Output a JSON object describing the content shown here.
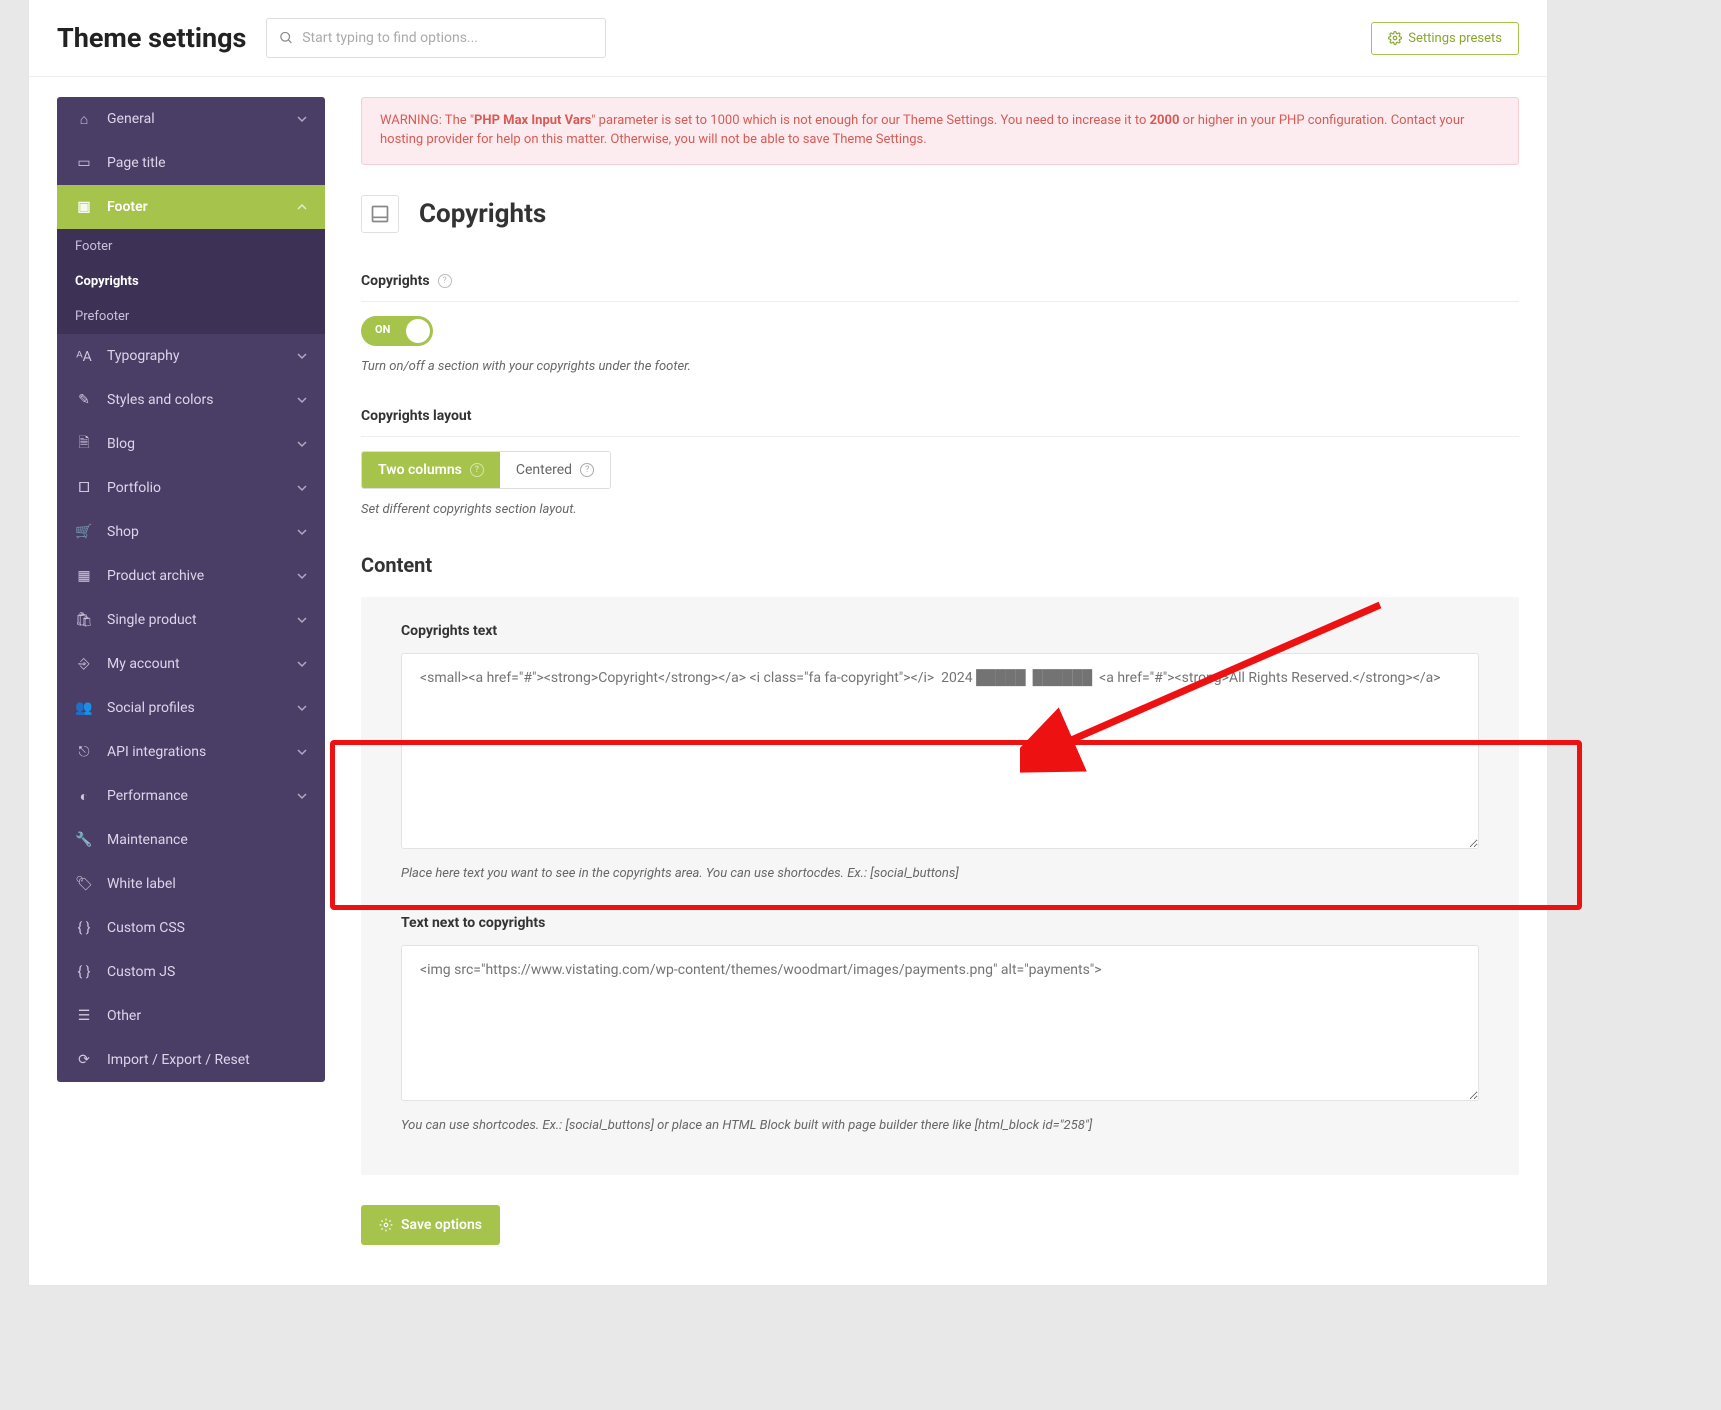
{
  "header": {
    "title": "Theme settings",
    "search_placeholder": "Start typing to find options...",
    "presets_label": "Settings presets"
  },
  "sidebar": {
    "items": [
      {
        "label": "General",
        "icon": "home",
        "chev": true
      },
      {
        "label": "Page title",
        "icon": "page",
        "chev": false
      },
      {
        "label": "Footer",
        "icon": "layout",
        "chev": true,
        "active": true
      },
      {
        "label": "Typography",
        "icon": "type",
        "chev": true
      },
      {
        "label": "Styles and colors",
        "icon": "brush",
        "chev": true
      },
      {
        "label": "Blog",
        "icon": "doc",
        "chev": true
      },
      {
        "label": "Portfolio",
        "icon": "briefcase",
        "chev": true
      },
      {
        "label": "Shop",
        "icon": "cart",
        "chev": true
      },
      {
        "label": "Product archive",
        "icon": "archive",
        "chev": true
      },
      {
        "label": "Single product",
        "icon": "bag",
        "chev": true
      },
      {
        "label": "My account",
        "icon": "user-exit",
        "chev": true
      },
      {
        "label": "Social profiles",
        "icon": "users",
        "chev": true
      },
      {
        "label": "API integrations",
        "icon": "share",
        "chev": true
      },
      {
        "label": "Performance",
        "icon": "gauge",
        "chev": true
      },
      {
        "label": "Maintenance",
        "icon": "wrench",
        "chev": false
      },
      {
        "label": "White label",
        "icon": "tag",
        "chev": false
      },
      {
        "label": "Custom CSS",
        "icon": "code",
        "chev": false
      },
      {
        "label": "Custom JS",
        "icon": "code",
        "chev": false
      },
      {
        "label": "Other",
        "icon": "list",
        "chev": false
      },
      {
        "label": "Import / Export / Reset",
        "icon": "refresh",
        "chev": false
      }
    ],
    "footer_sub": [
      {
        "label": "Footer"
      },
      {
        "label": "Copyrights",
        "active": true
      },
      {
        "label": "Prefooter"
      }
    ]
  },
  "warning": {
    "pre": "WARNING: The \"",
    "bold1": "PHP Max Input Vars",
    "mid": "\" parameter is set to 1000 which is not enough for our Theme Settings. You need to increase it to ",
    "bold2": "2000",
    "post": " or higher in your PHP configuration. Contact your hosting provider for help on this matter. Otherwise, you will not be able to save Theme Settings."
  },
  "section": {
    "title": "Copyrights"
  },
  "fields": {
    "copyrights_toggle": {
      "label": "Copyrights",
      "state": "ON",
      "help": "Turn on/off a section with your copyrights under the footer."
    },
    "layout": {
      "label": "Copyrights layout",
      "options": [
        {
          "label": "Two columns",
          "active": true
        },
        {
          "label": "Centered"
        }
      ],
      "help": "Set different copyrights section layout."
    }
  },
  "content": {
    "heading": "Content",
    "text1_label": "Copyrights text",
    "text1_value": "<small><a href=\"#\"><strong>Copyright</strong></a> <i class=\"fa fa-copyright\"></i>  2024 █████  ██████  <a href=\"#\"><strong>All Rights Reserved.</strong></a>",
    "text1_help": "Place here text you want to see in the copyrights area. You can use shortocdes. Ex.: [social_buttons]",
    "text2_label": "Text next to copyrights",
    "text2_value": "<img src=\"https://www.vistating.com/wp-content/themes/woodmart/images/payments.png\" alt=\"payments\">",
    "text2_help": "You can use shortcodes. Ex.: [social_buttons] or place an HTML Block built with page builder there like [html_block id=\"258\"]"
  },
  "save_label": "Save options"
}
